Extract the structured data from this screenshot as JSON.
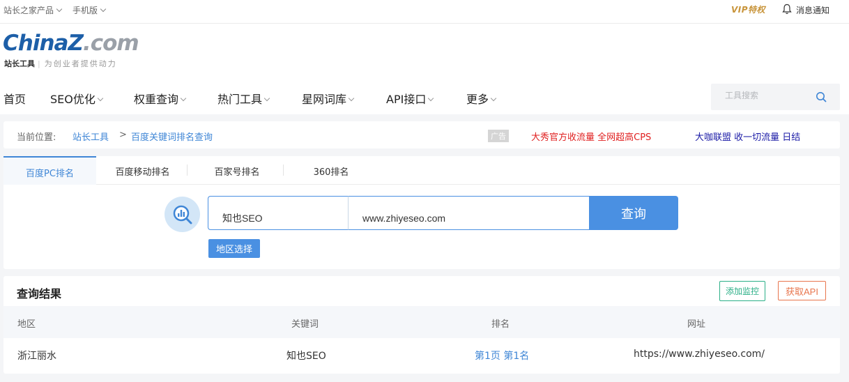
{
  "topbar": {
    "products": "站长之家产品",
    "mobile": "手机版",
    "vip": "VIP特权",
    "notice": "消息通知"
  },
  "logo": {
    "part1": "China",
    "part2": "Z",
    "part3": ".com",
    "sub_strong": "站长工具",
    "sub": "为创业者提供动力"
  },
  "nav": [
    "首页",
    "SEO优化",
    "权重查询",
    "热门工具",
    "星网词库",
    "API接口",
    "更多"
  ],
  "tool_search": {
    "placeholder": "工具搜索"
  },
  "breadcrumb": {
    "prefix": "当前位置:",
    "home": "站长工具",
    "sep": ">",
    "current": "百度关键词排名查询",
    "ad_tag": "广告",
    "ad1": "大秀官方收流量 全网超高CPS",
    "ad2": "大咖联盟 收一切流量 日结"
  },
  "tabs": [
    "百度PC排名",
    "百度移动排名",
    "百家号排名",
    "360排名"
  ],
  "query": {
    "keyword": "知也SEO",
    "url": "www.zhiyeseo.com",
    "button": "查询",
    "region_button": "地区选择"
  },
  "results": {
    "title": "查询结果",
    "add_monitor": "添加监控",
    "get_api": "获取API",
    "columns": [
      "地区",
      "关键词",
      "排名",
      "网址"
    ],
    "rows": [
      {
        "region": "浙江丽水",
        "keyword": "知也SEO",
        "rank": "第1页 第1名",
        "url": "https://www.zhiyeseo.com/"
      }
    ]
  },
  "colors": {
    "accent": "#4a90e2",
    "ad1": "#e02020",
    "ad2": "#1a1aa6",
    "monitor": "#2baf87",
    "api": "#e8754d"
  }
}
